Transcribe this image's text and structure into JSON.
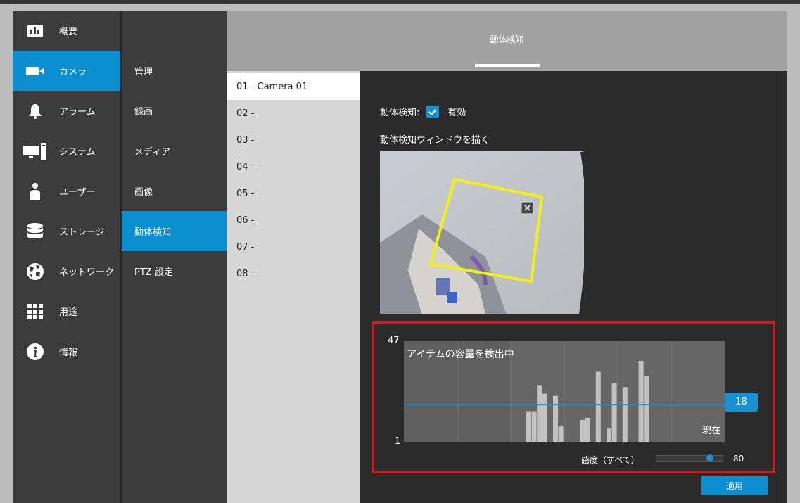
{
  "sidebar": {
    "items": [
      {
        "label": "概要",
        "icon": "overview-chart-icon"
      },
      {
        "label": "カメラ",
        "icon": "camera-icon",
        "active": true
      },
      {
        "label": "アラーム",
        "icon": "bell-icon"
      },
      {
        "label": "システム",
        "icon": "computer-icon"
      },
      {
        "label": "ユーザー",
        "icon": "user-icon"
      },
      {
        "label": "ストレージ",
        "icon": "database-icon"
      },
      {
        "label": "ネットワーク",
        "icon": "globe-icon"
      },
      {
        "label": "用途",
        "icon": "apps-grid-icon"
      },
      {
        "label": "情報",
        "icon": "info-icon"
      }
    ]
  },
  "subnav": {
    "items": [
      {
        "label": "管理"
      },
      {
        "label": "録画"
      },
      {
        "label": "メディア"
      },
      {
        "label": "画像"
      },
      {
        "label": "動体検知",
        "active": true
      },
      {
        "label": "PTZ 設定"
      }
    ]
  },
  "header": {
    "title": "動体検知"
  },
  "cameras": [
    "01 - Camera 01",
    "02 -",
    "03 -",
    "04 -",
    "05 -",
    "06 -",
    "07 -",
    "08 -"
  ],
  "motion": {
    "enable_label": "動体検知:",
    "enabled": true,
    "enabled_text": "有効",
    "draw_window_label": "動体検知ウィンドウを描く"
  },
  "detection": {
    "y_max": "47",
    "y_min": "1",
    "title": "アイテムの容量を検出中",
    "now_label": "現在",
    "threshold": "18",
    "sensitivity_label": "感度（すべて）",
    "sensitivity_value": "80"
  },
  "chart_data": {
    "type": "bar",
    "ylim": [
      1,
      47
    ],
    "threshold": 18,
    "values": [
      15,
      15,
      27,
      23,
      1,
      22,
      8,
      1,
      1,
      1,
      11,
      12,
      1,
      33,
      1,
      7,
      28,
      1,
      26,
      1,
      1,
      38,
      31
    ],
    "grid": true
  },
  "apply_label": "適用",
  "colors": {
    "accent": "#0a8ed0",
    "highlight": "#e0141a",
    "zone": "#f2ef14"
  }
}
